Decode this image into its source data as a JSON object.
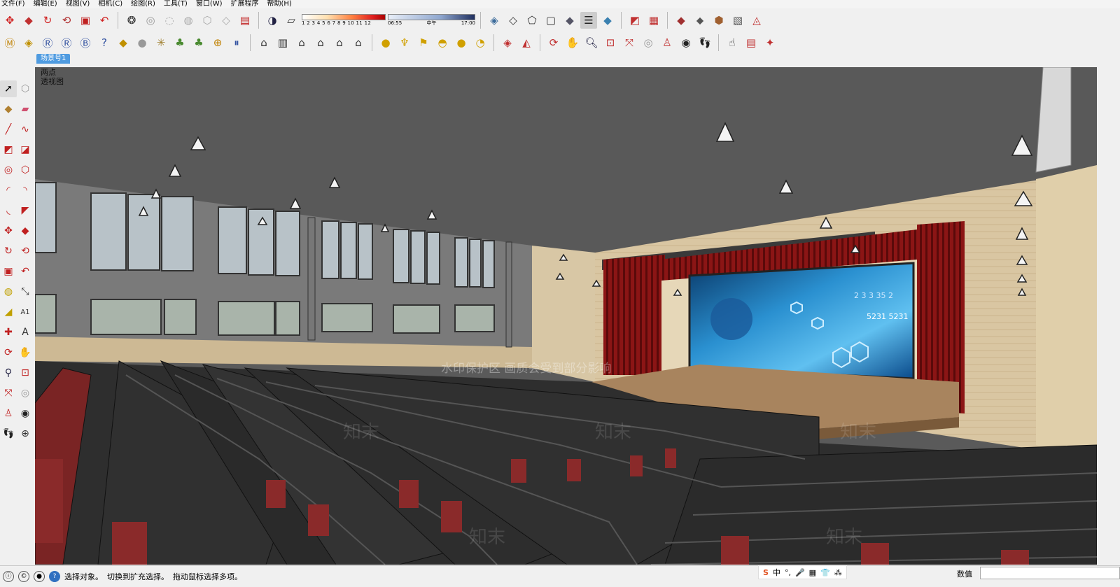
{
  "menu": [
    "文件(F)",
    "编辑(E)",
    "视图(V)",
    "相机(C)",
    "绘图(R)",
    "工具(T)",
    "窗口(W)",
    "扩展程序",
    "帮助(H)"
  ],
  "shadow_scale": {
    "numbers": "1 2 3 4 5 6 7 8 9 10 11 12"
  },
  "time_slider": {
    "start": "06:55",
    "mid": "中午",
    "end": "17:00"
  },
  "scene_tab": "场景号1",
  "view_label": {
    "line1": "两点",
    "line2": "透视图"
  },
  "watermark": {
    "notice": "水印保护区 画质会受到部分影响",
    "brand": "知末"
  },
  "status": {
    "text1": "选择对象。",
    "text2": "切换到扩充选择。",
    "text3": "拖动鼠标选择多项。",
    "value_label": "数值"
  },
  "ime": [
    "S",
    "中",
    "°,",
    "🎤",
    "▦",
    "👕",
    "⁂"
  ],
  "screen_text": {
    "line1": "2 3 3  35  2",
    "line2": "5231 5231"
  },
  "colors": {
    "curtain": "#8b1a1a",
    "seat": "#3a3a3a",
    "seat_red": "#8a2a2a",
    "ceiling": "#585858",
    "wall": "#d8c7a5",
    "floor": "#2c2c2c"
  }
}
